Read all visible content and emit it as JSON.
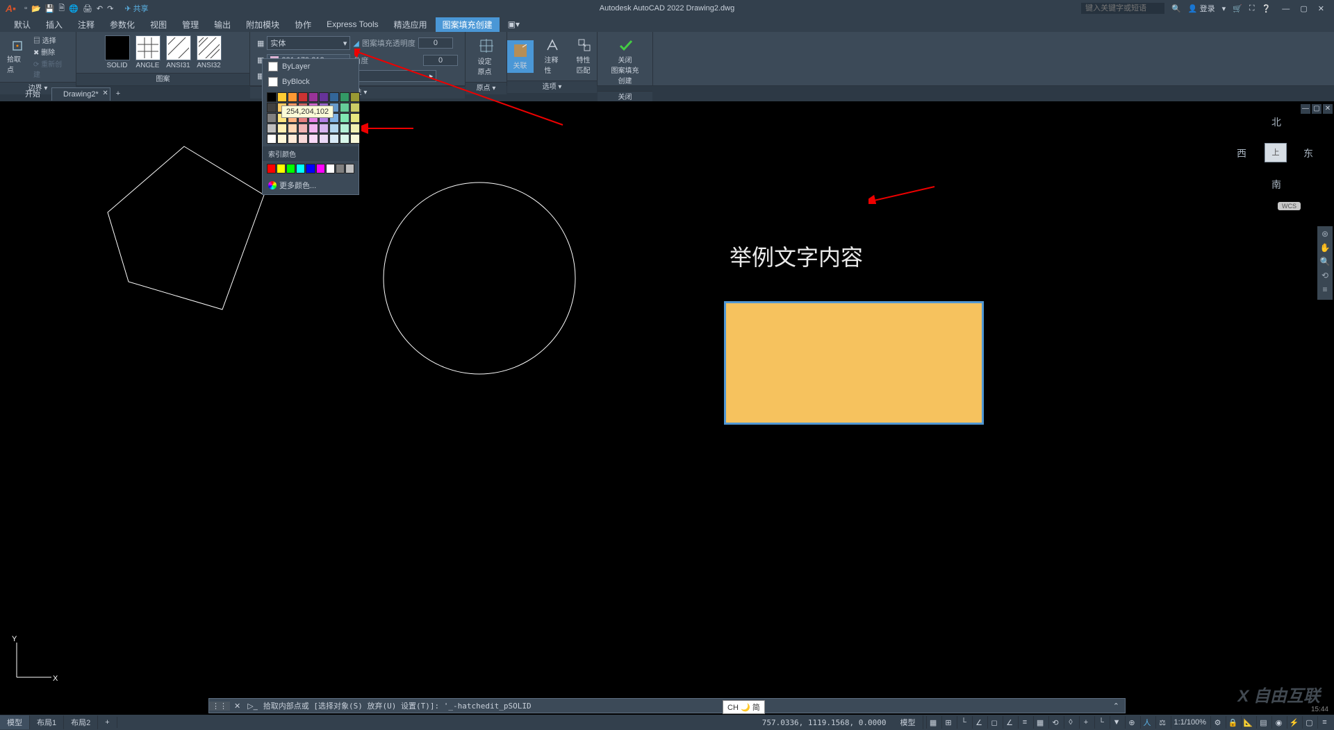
{
  "title": "Autodesk AutoCAD 2022   Drawing2.dwg",
  "share": "共享",
  "search_placeholder": "键入关键字或短语",
  "login": "登录",
  "menu": [
    "默认",
    "插入",
    "注释",
    "参数化",
    "视图",
    "管理",
    "输出",
    "附加模块",
    "协作",
    "Express Tools",
    "精选应用",
    "图案填充创建"
  ],
  "menu_active": 11,
  "ribbon": {
    "p1": {
      "select": "选择",
      "delete": "删除",
      "rebuild": "重新创建",
      "pick": "拾取点",
      "title": "边界 ▾"
    },
    "p2": {
      "pats": [
        "SOLID",
        "ANGLE",
        "ANSI31",
        "ANSI32"
      ],
      "title": "图案"
    },
    "p3": {
      "type": "实体",
      "color": "221,179,212",
      "trans_label": "图案填充透明度",
      "trans": "0",
      "angle_label": "角度",
      "angle": "0",
      "title": "特性 ▾"
    },
    "p4": {
      "origin": "设定原点",
      "title": "原点 ▾"
    },
    "p5": {
      "assoc": "关联",
      "annot": "注释性",
      "match": "特性匹配",
      "title": "选项 ▾"
    },
    "p6": {
      "close": "关闭\n图案填充创建",
      "title": "关闭"
    }
  },
  "tabs": {
    "start": "开始",
    "file": "Drawing2*",
    "add": "+"
  },
  "color_popup": {
    "bylayer": "ByLayer",
    "byblock": "ByBlock",
    "index_label": "索引颜色",
    "more": "更多颜色...",
    "grid": [
      [
        "#000000",
        "#ffcc33",
        "#ff9933",
        "#cc3333",
        "#993399",
        "#663399",
        "#336699",
        "#339966",
        "#999933"
      ],
      [
        "#404040",
        "#ffcc66",
        "#ff9966",
        "#cc6666",
        "#cc66cc",
        "#9966cc",
        "#6699cc",
        "#66cc99",
        "#cccc66"
      ],
      [
        "#808080",
        "#ffe680",
        "#ffb380",
        "#e68080",
        "#e680e6",
        "#b380e6",
        "#80b3e6",
        "#80e6b3",
        "#e6e680"
      ],
      [
        "#bfbfbf",
        "#fff0b3",
        "#ffd6b3",
        "#f0b3b3",
        "#f0b3f0",
        "#d6b3f0",
        "#b3d6f0",
        "#b3f0d6",
        "#f0f0b3"
      ],
      [
        "#ffffff",
        "#fff8d9",
        "#ffebd9",
        "#f8d9d9",
        "#f8d9f8",
        "#ebd9f8",
        "#d9ebf8",
        "#d9f8eb",
        "#f8f8d9"
      ]
    ],
    "index": [
      "#ff0000",
      "#ffff00",
      "#00ff00",
      "#00ffff",
      "#0000ff",
      "#ff00ff",
      "#ffffff",
      "#808080",
      "#c0c0c0"
    ]
  },
  "tooltip": "254,204,102",
  "viewcube": {
    "n": "北",
    "s": "南",
    "e": "东",
    "w": "西",
    "top": "上",
    "wcs": "WCS"
  },
  "drawing_text": "举例文字内容",
  "cmd": {
    "prompt": "▷",
    "text": "拾取内部点或 [选择对象(S) 放弃(U) 设置(T)]: '_-hatchedit_pSOLID"
  },
  "status": {
    "tabs": [
      "模型",
      "布局1",
      "布局2"
    ],
    "coords": "757.0336, 1119.1568, 0.0000",
    "model": "模型",
    "scale": "1:1/100%"
  },
  "ime": "CH 🌙 简",
  "watermark": "X 自由互联",
  "time": "15:44"
}
